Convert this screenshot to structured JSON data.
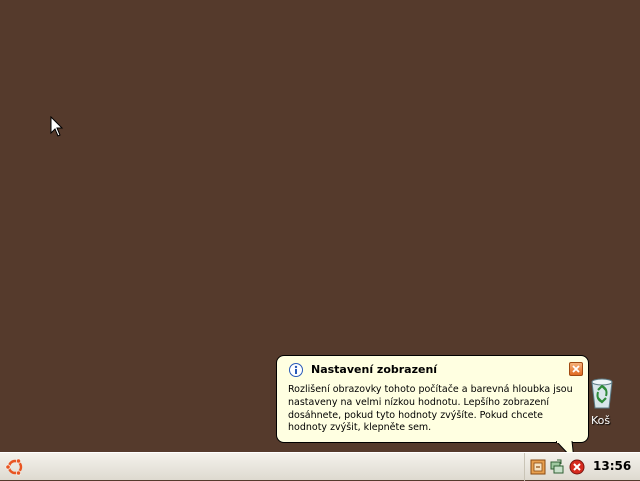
{
  "desktop": {
    "background_color": "#553a2c",
    "recycle_bin": {
      "label": "Koš",
      "icon": "recycle-bin-icon"
    }
  },
  "balloon": {
    "icon": "info-icon",
    "title": "Nastavení zobrazení",
    "body": "Rozlišení obrazovky tohoto počítače a barevná hloubka jsou nastaveny na velmi nízkou hodnotu. Lepšího zobrazení dosáhnete, pokud tyto hodnoty zvýšíte. Pokud chcete hodnoty zvýšit, klepněte sem.",
    "close_icon": "close-icon",
    "background_color": "#ffffe1",
    "close_color": "#e06a22"
  },
  "taskbar": {
    "start_icon": "ubuntu-logo-icon",
    "start_color": "#e95420",
    "tray": {
      "icons": [
        "app-tray-icon",
        "network-icon",
        "error-icon"
      ],
      "clock": "13:56"
    }
  }
}
